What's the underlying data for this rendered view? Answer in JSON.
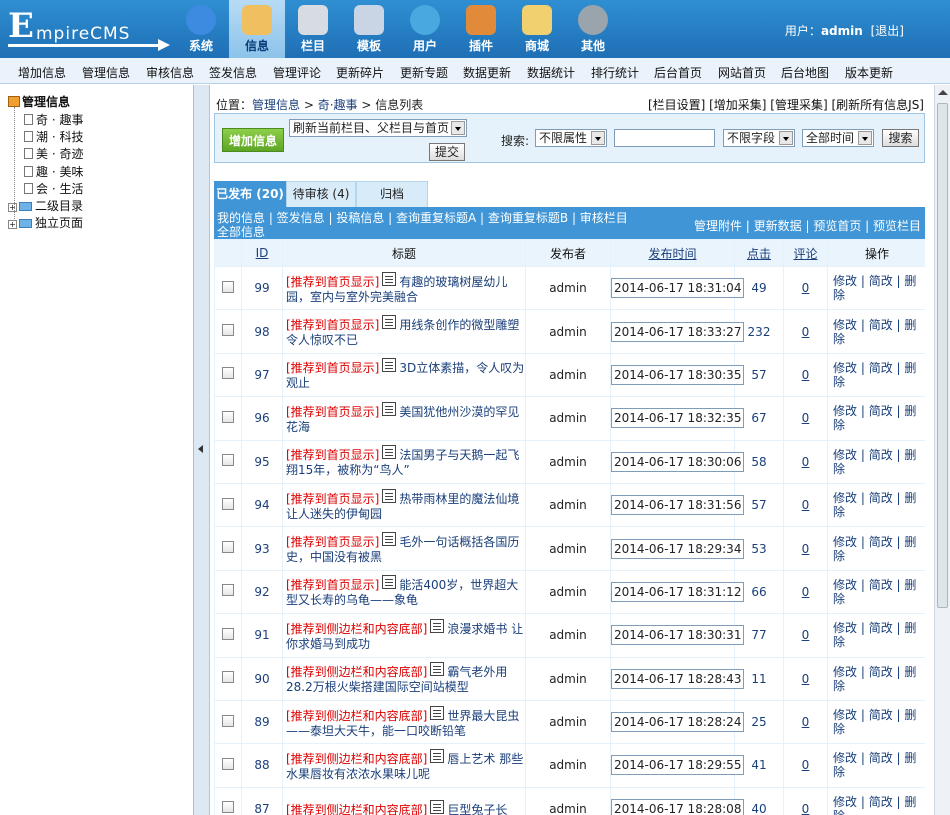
{
  "header": {
    "logo_text": "EmpireCMS",
    "nav": [
      {
        "label": "系统",
        "icon": "globe-icon",
        "color": "#3c8be0"
      },
      {
        "label": "信息",
        "icon": "document-edit-icon",
        "color": "#f0c060"
      },
      {
        "label": "栏目",
        "icon": "folder-icon",
        "color": "#d7dce2"
      },
      {
        "label": "模板",
        "icon": "template-icon",
        "color": "#c9d5e4"
      },
      {
        "label": "用户",
        "icon": "user-icon",
        "color": "#4aa8e0"
      },
      {
        "label": "插件",
        "icon": "plugin-tools-icon",
        "color": "#e08a3a"
      },
      {
        "label": "商城",
        "icon": "shop-card-icon",
        "color": "#f1d070"
      },
      {
        "label": "其他",
        "icon": "gear-icon",
        "color": "#9aa4ad"
      }
    ],
    "user_label": "用户：",
    "user_name": "admin",
    "logout": "[退出]"
  },
  "menubar": [
    "增加信息",
    "管理信息",
    "审核信息",
    "签发信息",
    "管理评论",
    "更新碎片",
    "更新专题",
    "数据更新",
    "数据统计",
    "排行统计",
    "后台首页",
    "网站首页",
    "后台地图",
    "版本更新"
  ],
  "tree": {
    "root": "管理信息",
    "children": [
      "奇 · 趣事",
      "潮 · 科技",
      "美 · 奇迹",
      "趣 · 美味",
      "会 · 生活"
    ],
    "groups": [
      "二级目录",
      "独立页面"
    ]
  },
  "main": {
    "crumb": {
      "prefix": "位置：",
      "a": "管理信息",
      "sep1": " > ",
      "b": "奇·趣事",
      "sep2": " > ",
      "c": "信息列表"
    },
    "crumb_right": "[栏目设置] [增加采集] [管理采集] [刷新所有信息JS]",
    "toolbox": {
      "add_button": "增加信息",
      "refresh_select": "刷新当前栏目、父栏目与首页",
      "submit": "提交",
      "search_label": "搜索:",
      "attr_select": "不限属性",
      "search_value": "",
      "field_select": "不限字段",
      "time_select": "全部时间",
      "search_button": "搜索"
    },
    "tabs": [
      "已发布 (20)",
      "待审核 (4)",
      "归档"
    ],
    "listlinks": "我的信息 | 签发信息 | 投稿信息 | 查询重复标题A | 查询重复标题B | 审核栏目全部信息",
    "listlinks_right": "管理附件 | 更新数据 | 预览首页 | 预览栏目",
    "columns": [
      "ID",
      "标题",
      "发布者",
      "发布时间",
      "点击",
      "评论",
      "操作"
    ],
    "ops_labels": [
      "修改",
      "简改",
      "删除"
    ],
    "rows": [
      {
        "id": "99",
        "flag": "[推荐到首页显示]",
        "title": "有趣的玻璃树屋幼儿园，室内与室外完美融合",
        "author": "admin",
        "time": "2014-06-17 18:31:04",
        "hits": "49",
        "comments": "0"
      },
      {
        "id": "98",
        "flag": "[推荐到首页显示]",
        "title": "用线条创作的微型雕塑 令人惊叹不已",
        "author": "admin",
        "time": "2014-06-17 18:33:27",
        "hits": "232",
        "comments": "0"
      },
      {
        "id": "97",
        "flag": "[推荐到首页显示]",
        "title": "3D立体素描，令人叹为观止",
        "author": "admin",
        "time": "2014-06-17 18:30:35",
        "hits": "57",
        "comments": "0"
      },
      {
        "id": "96",
        "flag": "[推荐到首页显示]",
        "title": "美国犹他州沙漠的罕见花海",
        "author": "admin",
        "time": "2014-06-17 18:32:35",
        "hits": "67",
        "comments": "0"
      },
      {
        "id": "95",
        "flag": "[推荐到首页显示]",
        "title": "法国男子与天鹅一起飞翔15年，被称为“鸟人”",
        "author": "admin",
        "time": "2014-06-17 18:30:06",
        "hits": "58",
        "comments": "0"
      },
      {
        "id": "94",
        "flag": "[推荐到首页显示]",
        "title": "热带雨林里的魔法仙境 让人迷失的伊甸园",
        "author": "admin",
        "time": "2014-06-17 18:31:56",
        "hits": "57",
        "comments": "0"
      },
      {
        "id": "93",
        "flag": "[推荐到首页显示]",
        "title": "毛外一句话概括各国历史，中国没有被黑",
        "author": "admin",
        "time": "2014-06-17 18:29:34",
        "hits": "53",
        "comments": "0"
      },
      {
        "id": "92",
        "flag": "[推荐到首页显示]",
        "title": "能活400岁，世界超大型又长寿的乌龟——象龟",
        "author": "admin",
        "time": "2014-06-17 18:31:12",
        "hits": "66",
        "comments": "0"
      },
      {
        "id": "91",
        "flag": "[推荐到侧边栏和内容底部]",
        "title": "浪漫求婚书 让你求婚马到成功",
        "author": "admin",
        "time": "2014-06-17 18:30:31",
        "hits": "77",
        "comments": "0"
      },
      {
        "id": "90",
        "flag": "[推荐到侧边栏和内容底部]",
        "title": "霸气老外用28.2万根火柴搭建国际空间站模型",
        "author": "admin",
        "time": "2014-06-17 18:28:43",
        "hits": "11",
        "comments": "0"
      },
      {
        "id": "89",
        "flag": "[推荐到侧边栏和内容底部]",
        "title": "世界最大昆虫——泰坦大天牛，能一口咬断铅笔",
        "author": "admin",
        "time": "2014-06-17 18:28:24",
        "hits": "25",
        "comments": "0"
      },
      {
        "id": "88",
        "flag": "[推荐到侧边栏和内容底部]",
        "title": "唇上艺术 那些水果唇妆有浓浓水果味儿呢",
        "author": "admin",
        "time": "2014-06-17 18:29:55",
        "hits": "41",
        "comments": "0"
      },
      {
        "id": "87",
        "flag": "[推荐到侧边栏和内容底部]",
        "title": "巨型兔子长",
        "author": "admin",
        "time": "2014-06-17 18:28:08",
        "hits": "40",
        "comments": "0"
      }
    ]
  }
}
